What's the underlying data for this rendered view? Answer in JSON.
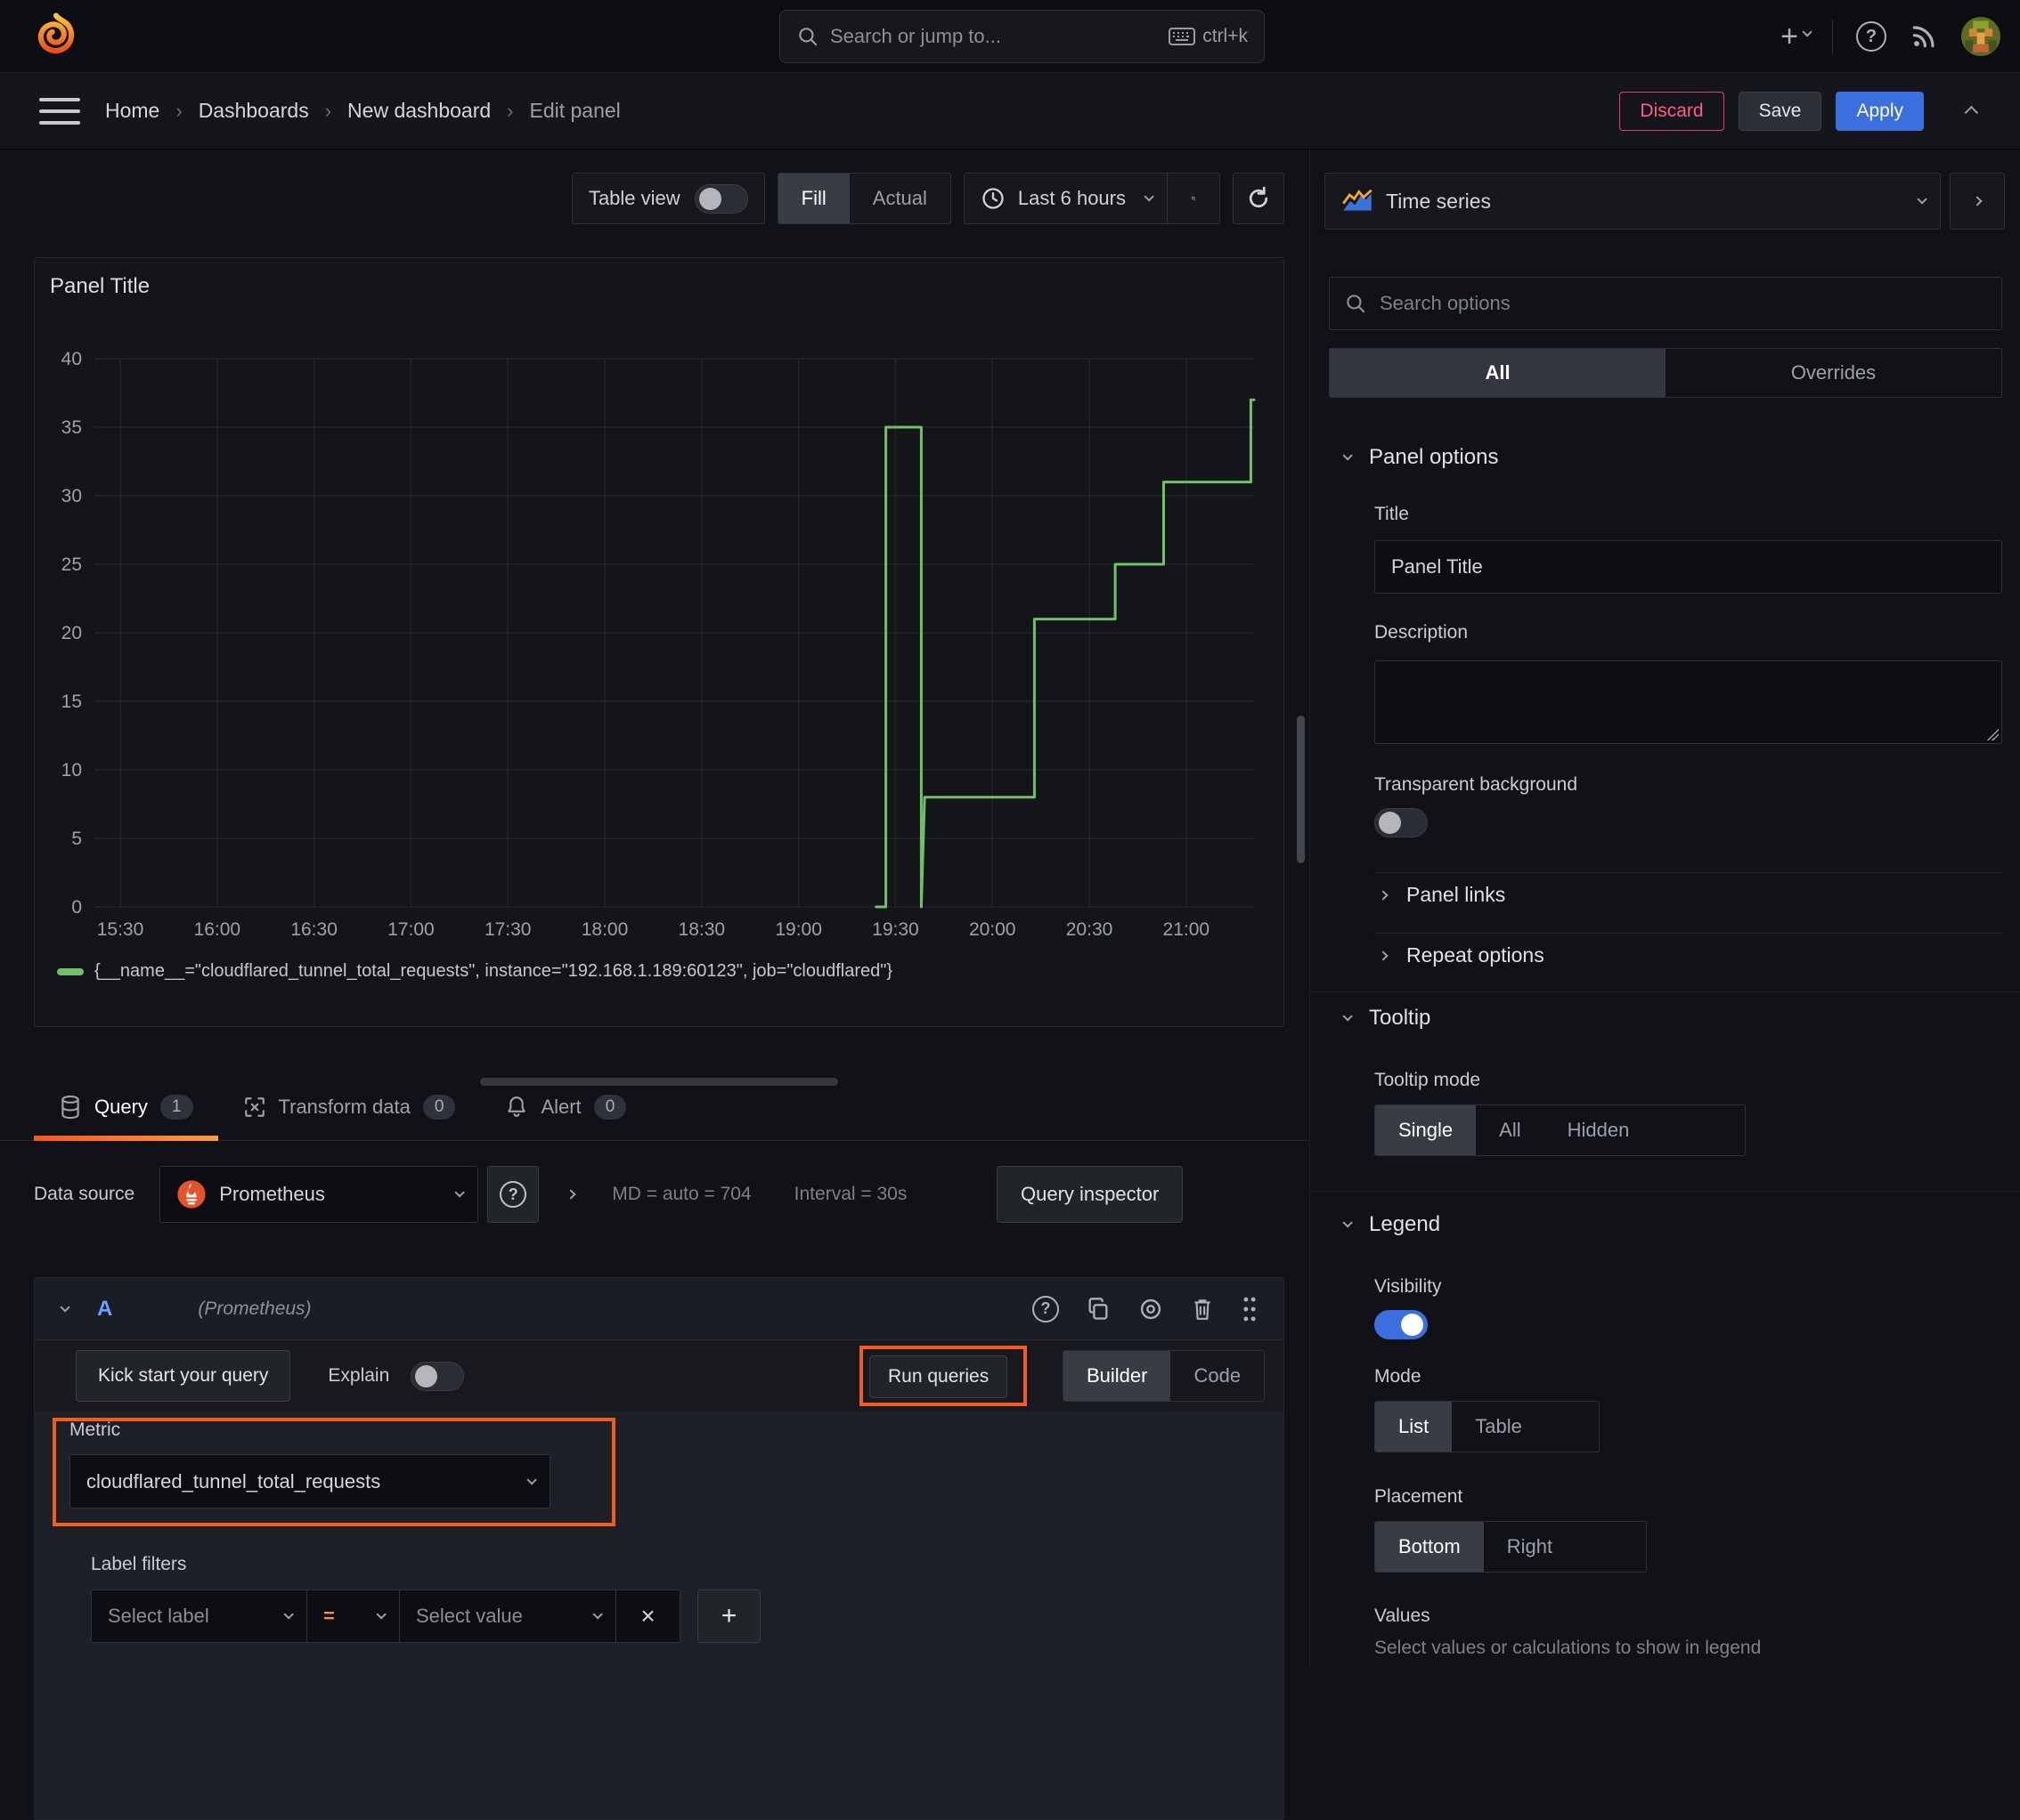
{
  "topnav": {
    "search_placeholder": "Search or jump to...",
    "shortcut": "ctrl+k"
  },
  "breadcrumb": {
    "items": [
      "Home",
      "Dashboards",
      "New dashboard",
      "Edit panel"
    ]
  },
  "actions": {
    "discard": "Discard",
    "save": "Save",
    "apply": "Apply"
  },
  "toolbar": {
    "table_view": "Table view",
    "fill": "Fill",
    "actual": "Actual",
    "time_range": "Last 6 hours"
  },
  "viz_picker": {
    "label": "Time series"
  },
  "options": {
    "search_placeholder": "Search options",
    "tabs": {
      "all": "All",
      "overrides": "Overrides"
    },
    "panel_options": {
      "header": "Panel options",
      "title_label": "Title",
      "title_value": "Panel Title",
      "description_label": "Description",
      "transparent_label": "Transparent background"
    },
    "panel_links_label": "Panel links",
    "repeat_options_label": "Repeat options",
    "tooltip": {
      "header": "Tooltip",
      "mode_label": "Tooltip mode",
      "modes": [
        "Single",
        "All",
        "Hidden"
      ],
      "active_mode": "Single"
    },
    "legend": {
      "header": "Legend",
      "visibility_label": "Visibility",
      "mode_label": "Mode",
      "modes": [
        "List",
        "Table"
      ],
      "active_mode": "List",
      "placement_label": "Placement",
      "placements": [
        "Bottom",
        "Right"
      ],
      "active_placement": "Bottom",
      "values_label": "Values",
      "values_desc": "Select values or calculations to show in legend"
    }
  },
  "editor": {
    "tabs": [
      {
        "label": "Query",
        "count": "1"
      },
      {
        "label": "Transform data",
        "count": "0"
      },
      {
        "label": "Alert",
        "count": "0"
      }
    ],
    "datasource": {
      "label": "Data source",
      "name": "Prometheus",
      "stats_md": "MD = auto = 704",
      "stats_interval": "Interval = 30s",
      "inspector": "Query inspector"
    },
    "query": {
      "ref": "A",
      "ds_hint": "(Prometheus)",
      "kickstart": "Kick start your query",
      "explain": "Explain",
      "run": "Run queries",
      "builder": "Builder",
      "code": "Code",
      "metric_label": "Metric",
      "metric_value": "cloudflared_tunnel_total_requests",
      "label_filters": "Label filters",
      "select_label": "Select label",
      "operator": "=",
      "select_value": "Select value"
    }
  },
  "chart_data": {
    "type": "line",
    "style": "step",
    "title": "Panel Title",
    "xlabel": "",
    "ylabel": "",
    "ylim": [
      0,
      40
    ],
    "y_ticks": [
      0,
      5,
      10,
      15,
      20,
      25,
      30,
      35,
      40
    ],
    "x_ticks": [
      "15:30",
      "16:00",
      "16:30",
      "17:00",
      "17:30",
      "18:00",
      "18:30",
      "19:00",
      "19:30",
      "20:00",
      "20:30",
      "21:00"
    ],
    "x_min": "15:22",
    "x_max": "21:21",
    "grid": true,
    "legend_position": "bottom",
    "legend": [
      {
        "label": "{__name__=\"cloudflared_tunnel_total_requests\", instance=\"192.168.1.189:60123\", job=\"cloudflared\"}",
        "color": "#73bf69"
      }
    ],
    "series": [
      {
        "name": "cloudflared_tunnel_total_requests",
        "color": "#73bf69",
        "points": [
          [
            "19:24",
            0
          ],
          [
            "19:27",
            0
          ],
          [
            "19:27",
            35
          ],
          [
            "19:38",
            35
          ],
          [
            "19:38",
            0
          ],
          [
            "19:39",
            8
          ],
          [
            "20:13",
            8
          ],
          [
            "20:13",
            21
          ],
          [
            "20:38",
            21
          ],
          [
            "20:38",
            25
          ],
          [
            "20:53",
            25
          ],
          [
            "20:53",
            31
          ],
          [
            "21:20",
            31
          ],
          [
            "21:20",
            37
          ],
          [
            "21:21",
            37
          ]
        ]
      }
    ]
  }
}
